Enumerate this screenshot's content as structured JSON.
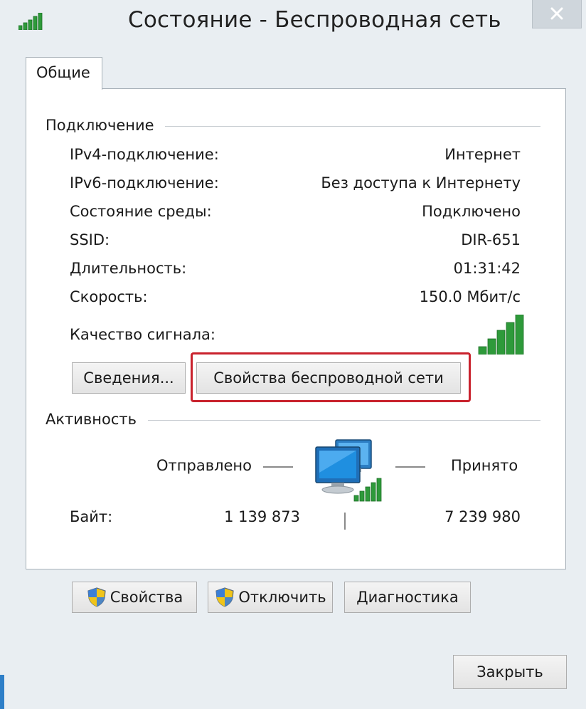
{
  "window": {
    "title": "Состояние - Беспроводная сеть",
    "icon": "wifi-signal-icon",
    "close_icon": "close-icon"
  },
  "tabs": [
    {
      "label": "Общие",
      "active": true
    }
  ],
  "connection": {
    "heading": "Подключение",
    "rows": [
      {
        "label": "IPv4-подключение:",
        "value": "Интернет"
      },
      {
        "label": "IPv6-подключение:",
        "value": "Без доступа к Интернету"
      },
      {
        "label": "Состояние среды:",
        "value": "Подключено"
      },
      {
        "label": "SSID:",
        "value": "DIR-651"
      },
      {
        "label": "Длительность:",
        "value": "01:31:42"
      },
      {
        "label": "Скорость:",
        "value": "150.0 Мбит/с"
      }
    ],
    "signal_label": "Качество сигнала:",
    "signal_bars": 5,
    "signal_max": 5,
    "details_button": "Сведения...",
    "wireless_props_button": "Свойства беспроводной сети"
  },
  "activity": {
    "heading": "Активность",
    "sent_label": "Отправлено",
    "received_label": "Принято",
    "bytes_label": "Байт:",
    "bytes_sent": "1 139 873",
    "bytes_received": "7 239 980"
  },
  "buttons": {
    "properties": "Свойства",
    "disable": "Отключить",
    "diagnose": "Диагностика",
    "close": "Закрыть"
  },
  "colors": {
    "signal_green": "#2e9a3a",
    "highlight_red": "#c9222d",
    "monitor_blue": "#1f8fe0"
  }
}
